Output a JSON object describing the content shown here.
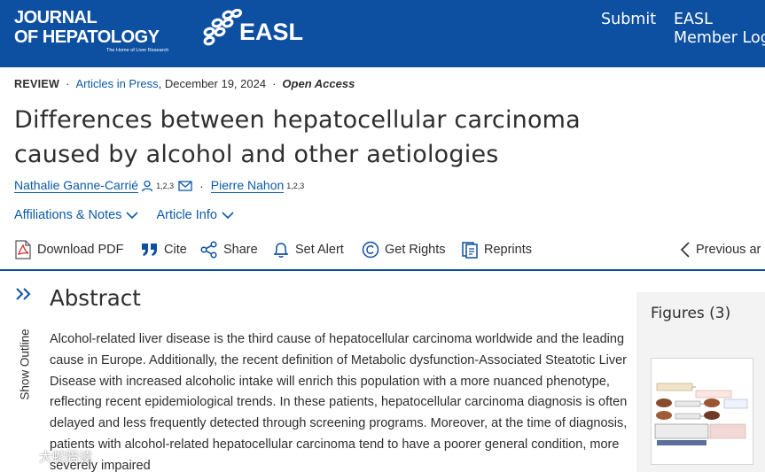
{
  "header": {
    "journal_line1": "JOURNAL",
    "journal_line2": "OF HEPATOLOGY",
    "journal_tagline": "The Home of Liver Research",
    "society_logo": "EASL",
    "nav_submit": "Submit",
    "nav_member_login": "EASL\nMember Login",
    "brand_color": "#0d4fa1"
  },
  "meta": {
    "article_type": "REVIEW",
    "section_link": "Articles in Press",
    "date": ", December 19, 2024",
    "access": "Open Access"
  },
  "article": {
    "title": "Differences between hepatocellular carcinoma caused by alcohol and other aetiologies",
    "authors": [
      {
        "name": "Nathalie Ganne-Carrié",
        "affil": "1,2,3"
      },
      {
        "name": "Pierre Nahon",
        "affil": "1,2,3"
      }
    ],
    "affiliations_toggle": "Affiliations & Notes",
    "article_info_toggle": "Article Info"
  },
  "toolbar": {
    "download_pdf": "Download PDF",
    "cite": "Cite",
    "share": "Share",
    "set_alert": "Set Alert",
    "get_rights": "Get Rights",
    "reprints": "Reprints",
    "previous": "Previous ar"
  },
  "sidebar": {
    "outline_label": "Show Outline"
  },
  "abstract": {
    "heading": "Abstract",
    "text": "Alcohol-related liver disease is the third cause of hepatocellular carcinoma worldwide and the leading cause in Europe. Additionally, the recent definition of Metabolic dysfunction-Associated Steatotic Liver Disease with increased alcoholic intake will enrich this population with a more nuanced phenotype, reflecting recent epidemiological trends. In these patients, hepatocellular carcinoma diagnosis is often delayed and less frequently detected through screening programs. Moreover, at the time of diagnosis, patients with alcohol-related hepatocellular carcinoma tend to have a poorer general condition, more severely impaired"
  },
  "figures": {
    "title": "Figures (3)"
  },
  "watermark": {
    "text": "大蛇陪读"
  }
}
